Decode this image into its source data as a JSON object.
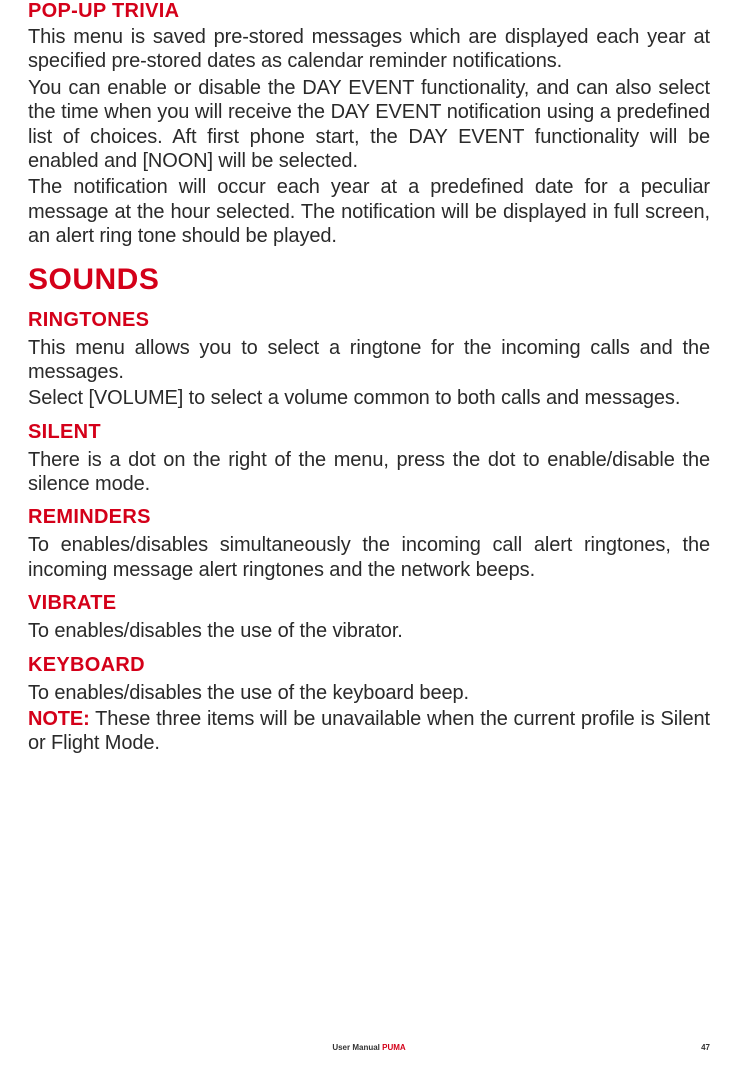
{
  "sections": {
    "popup": {
      "title": "POP-UP TRIVIA",
      "p1": "This menu is saved pre-stored messages which are displayed each year at specified pre-stored dates as calendar reminder notifications.",
      "p2": "You can enable or disable the DAY EVENT functionality, and can also select the time when you will receive the DAY EVENT notification using a predefined list of choices. Aft first phone start, the DAY EVENT functionality will be enabled and [NOON] will be selected.",
      "p3": "The notification will occur each year at a predefined date for a peculiar message at the hour selected. The notification will be displayed in full screen, an alert ring tone should be played."
    },
    "sounds": {
      "title": "SOUNDS",
      "ringtones": {
        "title": "RINGTONES",
        "p1": "This menu allows you to select a ringtone for the incoming calls and the messages.",
        "p2": "Select [VOLUME] to select a volume common to both calls and messages."
      },
      "silent": {
        "title": "SILENT",
        "p1": "There is a dot on the right of the menu, press the dot to enable/disable the silence mode."
      },
      "reminders": {
        "title": "REMINDERS",
        "p1": "To enables/disables simultaneously the incoming call alert ringtones, the incoming message alert ringtones and the network beeps."
      },
      "vibrate": {
        "title": "VIBRATE",
        "p1": "To enables/disables the use of the vibrator."
      },
      "keyboard": {
        "title": "KEYBOARD",
        "p1": "To enables/disables the use of the keyboard beep.",
        "note_label": "NOTE:",
        "note_text": " These three items will be unavailable when the current profile is Silent or Flight Mode."
      }
    }
  },
  "footer": {
    "text": "User Manual ",
    "brand": "PUMA",
    "page": "47"
  }
}
